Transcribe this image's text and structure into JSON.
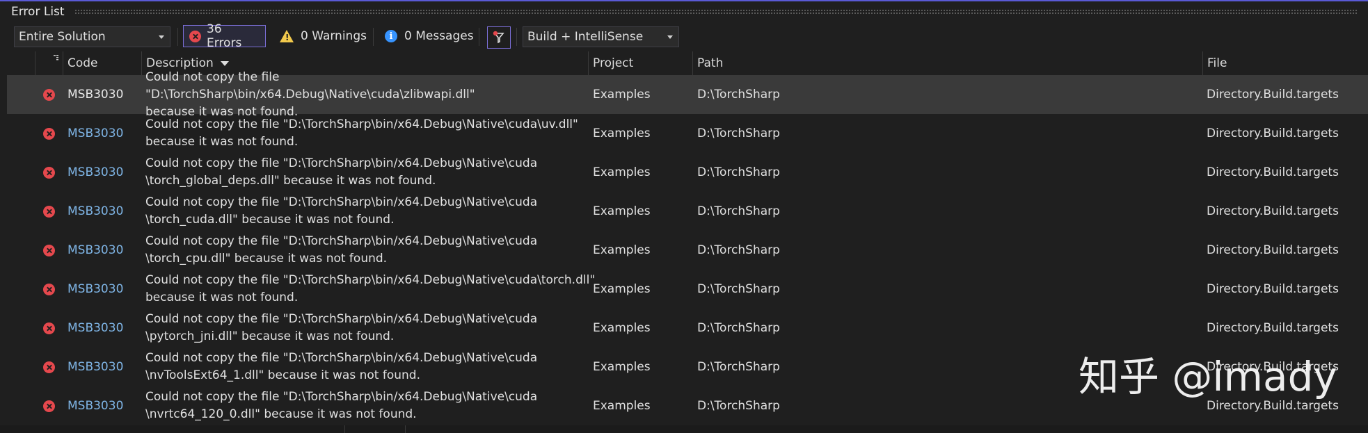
{
  "window": {
    "title": "Error List"
  },
  "toolbar": {
    "scope": "Entire Solution",
    "errors_label": "36 Errors",
    "warnings_label": "0 Warnings",
    "messages_label": "0 Messages",
    "source": "Build + IntelliSense"
  },
  "columns": {
    "code": "Code",
    "description": "Description",
    "project": "Project",
    "path": "Path",
    "file": "File"
  },
  "rows": [
    {
      "code": "MSB3030",
      "description": "Could not copy the file \"D:\\TorchSharp\\bin/x64.Debug\\Native\\cuda\\zlibwapi.dll\"\nbecause it was not found.",
      "project": "Examples",
      "path": "D:\\TorchSharp",
      "file": "Directory.Build.targets"
    },
    {
      "code": "MSB3030",
      "description": "Could not copy the file \"D:\\TorchSharp\\bin/x64.Debug\\Native\\cuda\\uv.dll\"\nbecause it was not found.",
      "project": "Examples",
      "path": "D:\\TorchSharp",
      "file": "Directory.Build.targets"
    },
    {
      "code": "MSB3030",
      "description": "Could not copy the file \"D:\\TorchSharp\\bin/x64.Debug\\Native\\cuda\n\\torch_global_deps.dll\" because it was not found.",
      "project": "Examples",
      "path": "D:\\TorchSharp",
      "file": "Directory.Build.targets"
    },
    {
      "code": "MSB3030",
      "description": "Could not copy the file \"D:\\TorchSharp\\bin/x64.Debug\\Native\\cuda\n\\torch_cuda.dll\" because it was not found.",
      "project": "Examples",
      "path": "D:\\TorchSharp",
      "file": "Directory.Build.targets"
    },
    {
      "code": "MSB3030",
      "description": "Could not copy the file \"D:\\TorchSharp\\bin/x64.Debug\\Native\\cuda\n\\torch_cpu.dll\" because it was not found.",
      "project": "Examples",
      "path": "D:\\TorchSharp",
      "file": "Directory.Build.targets"
    },
    {
      "code": "MSB3030",
      "description": "Could not copy the file \"D:\\TorchSharp\\bin/x64.Debug\\Native\\cuda\\torch.dll\"\nbecause it was not found.",
      "project": "Examples",
      "path": "D:\\TorchSharp",
      "file": "Directory.Build.targets"
    },
    {
      "code": "MSB3030",
      "description": "Could not copy the file \"D:\\TorchSharp\\bin/x64.Debug\\Native\\cuda\n\\pytorch_jni.dll\" because it was not found.",
      "project": "Examples",
      "path": "D:\\TorchSharp",
      "file": "Directory.Build.targets"
    },
    {
      "code": "MSB3030",
      "description": "Could not copy the file \"D:\\TorchSharp\\bin/x64.Debug\\Native\\cuda\n\\nvToolsExt64_1.dll\" because it was not found.",
      "project": "Examples",
      "path": "D:\\TorchSharp",
      "file": "Directory.Build.targets"
    },
    {
      "code": "MSB3030",
      "description": "Could not copy the file \"D:\\TorchSharp\\bin/x64.Debug\\Native\\cuda\n\\nvrtc64_120_0.dll\" because it was not found.",
      "project": "Examples",
      "path": "D:\\TorchSharp",
      "file": "Directory.Build.targets"
    }
  ],
  "watermark": "知乎 @imady"
}
